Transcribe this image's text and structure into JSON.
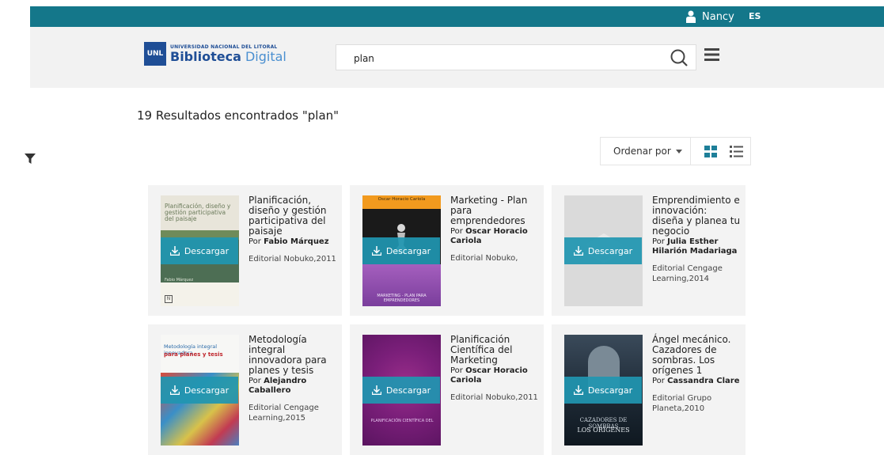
{
  "topbar": {
    "user_name": "Nancy",
    "language": "ES"
  },
  "logo": {
    "university": "UNIVERSIDAD NACIONAL DEL LITORAL",
    "badge": "UNL",
    "word_bold": "Biblioteca",
    "word_light": "Digital"
  },
  "search": {
    "value": "plan"
  },
  "results": {
    "heading": "19 Resultados encontrados \"plan\""
  },
  "sort": {
    "label": "Ordenar por"
  },
  "download_label": "Descargar",
  "books": [
    {
      "title": "Planificación, diseño y gestión participativa del paisaje",
      "by": "Por",
      "author": "Fabio Márquez",
      "publisher": "Editorial Nobuko,2011"
    },
    {
      "title": "Marketing - Plan para emprendedores",
      "by": "Por",
      "author": "Oscar Horacio Cariola",
      "publisher": "Editorial Nobuko,"
    },
    {
      "title": "Emprendimiento e innovación: diseña y planea tu negocio",
      "by": "Por",
      "author": "Julia Esther Hilarión Madariaga",
      "publisher": "Editorial Cengage Learning,2014"
    },
    {
      "title": "Metodología integral innovadora para planes y tesis",
      "by": "Por",
      "author": "Alejandro Caballero",
      "publisher": "Editorial Cengage Learning,2015"
    },
    {
      "title": "Planificación Científica del Marketing",
      "by": "Por",
      "author": "Oscar Horacio Cariola",
      "publisher": "Editorial Nobuko,2011"
    },
    {
      "title": "Ángel mecánico. Cazadores de sombras. Los orígenes 1",
      "by": "Por",
      "author": "Cassandra Clare",
      "publisher": "Editorial Grupo Planeta,2010"
    }
  ],
  "covers": {
    "c1": {
      "title": "Planificación, diseño y gestión participativa del paisaje",
      "author": "Fabio Márquez"
    },
    "c2": {
      "author": "Oscar Horacio Cariola",
      "title": "MARKETING - PLAN PARA EMPRENDEDORES"
    },
    "c4": {
      "title": "Metodología integral innovadora",
      "subtitle": "para planes y tesis"
    },
    "c5": {
      "title": "PLANIFICACIÓN CIENTÍFICA DEL"
    },
    "c6": {
      "title": "CAZADORES DE SOMBRAS",
      "subtitle": "LOS ORÍGENES"
    }
  },
  "colors": {
    "topbar": "#14778a",
    "header": "#f2f2f2",
    "card": "#f3f3f3",
    "download": "#2096b0",
    "logo": "#1f4e96"
  }
}
